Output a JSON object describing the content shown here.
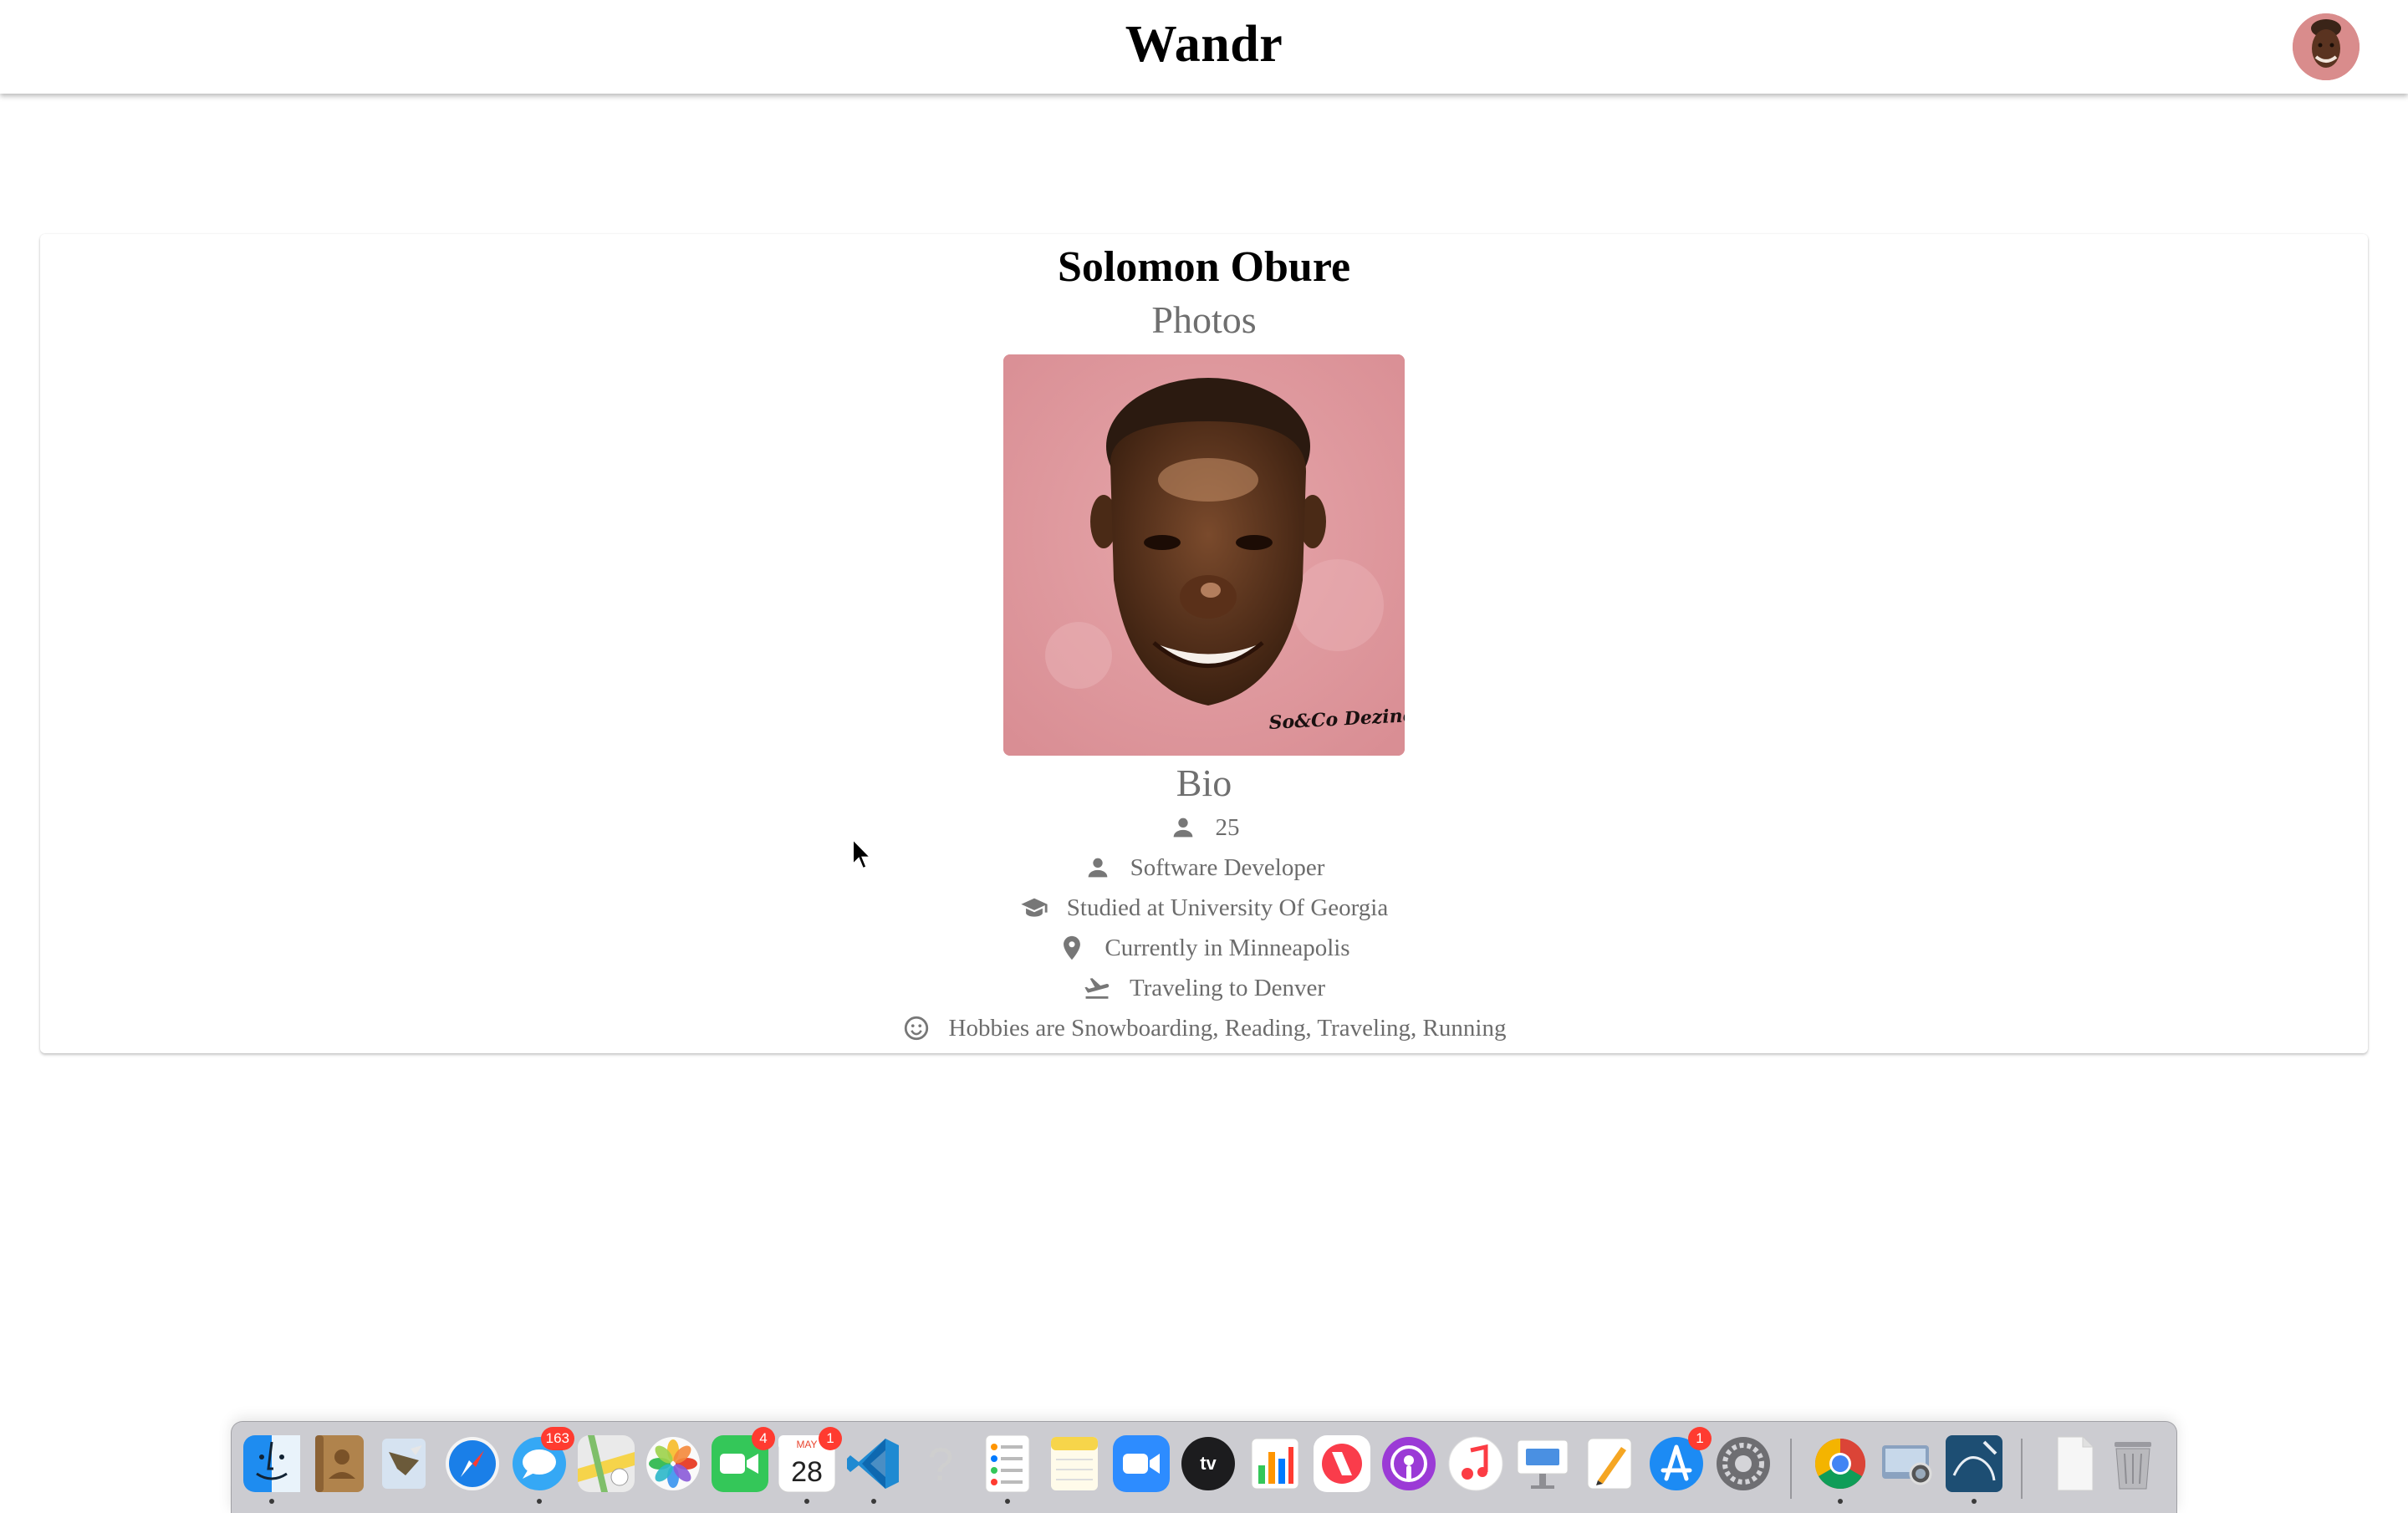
{
  "app": {
    "brand": "Wandr",
    "avatar_icon": "user-avatar"
  },
  "profile": {
    "name": "Solomon Obure",
    "photos_title": "Photos",
    "photo_watermark": "So&Co Dezine",
    "bio_title": "Bio",
    "bio": [
      {
        "icon": "person-icon",
        "text": "25"
      },
      {
        "icon": "person-icon",
        "text": "Software Developer"
      },
      {
        "icon": "graduation-cap-icon",
        "text": "Studied at University Of Georgia"
      },
      {
        "icon": "location-pin-icon",
        "text": "Currently in Minneapolis"
      },
      {
        "icon": "airplane-takeoff-icon",
        "text": "Traveling to Denver"
      },
      {
        "icon": "smiley-icon",
        "text": "Hobbies are Snowboarding, Reading, Traveling, Running"
      }
    ]
  },
  "dock": {
    "items": [
      {
        "name": "finder",
        "color": "#1e8cf0",
        "running": true
      },
      {
        "name": "contacts",
        "color": "#b0834c",
        "running": false
      },
      {
        "name": "preview-eagle",
        "color": "#9db7d6",
        "running": false
      },
      {
        "name": "safari",
        "color": "#1a7fe8",
        "running": false
      },
      {
        "name": "messages",
        "color": "#35a8f5",
        "running": true,
        "badge": "163"
      },
      {
        "name": "maps",
        "color": "#7fbf6a",
        "running": false
      },
      {
        "name": "photos",
        "color": "#f4f4f4",
        "running": false
      },
      {
        "name": "facetime",
        "color": "#34c759",
        "running": false,
        "badge": "4"
      },
      {
        "name": "calendar",
        "color": "#ffffff",
        "running": true,
        "badge": "1",
        "month": "MAY",
        "day": "28"
      },
      {
        "name": "vscode",
        "color": "#1f8ad2",
        "running": true
      },
      {
        "name": "help",
        "color": "#d8d8d8",
        "running": false
      },
      {
        "name": "reminders",
        "color": "#ffffff",
        "running": true
      },
      {
        "name": "notes",
        "color": "#f7d54a",
        "running": false
      },
      {
        "name": "zoom",
        "color": "#2d8cff",
        "running": false
      },
      {
        "name": "apple-tv",
        "color": "#1c1c1e",
        "running": false,
        "label": "tv"
      },
      {
        "name": "numbers",
        "color": "#ffffff",
        "running": false
      },
      {
        "name": "news",
        "color": "#ffffff",
        "running": false
      },
      {
        "name": "podcasts",
        "color": "#9b3ad6",
        "running": false
      },
      {
        "name": "music",
        "color": "#ffffff",
        "running": false
      },
      {
        "name": "keynote",
        "color": "#ffffff",
        "running": false
      },
      {
        "name": "pages",
        "color": "#ffffff",
        "running": false
      },
      {
        "name": "app-store",
        "color": "#1c8bf4",
        "running": false,
        "badge": "1"
      },
      {
        "name": "system-preferences",
        "color": "#6e6e72",
        "running": false
      },
      {
        "name": "chrome",
        "color": "#ffffff",
        "running": true
      },
      {
        "name": "image-capture",
        "color": "#8aa2c0",
        "running": false
      },
      {
        "name": "mysql-workbench",
        "color": "#1d4e73",
        "running": true
      },
      {
        "name": "document",
        "color": "#f6f6f6",
        "running": false
      },
      {
        "name": "trash",
        "color": "#b9b9bd",
        "running": false
      }
    ]
  }
}
